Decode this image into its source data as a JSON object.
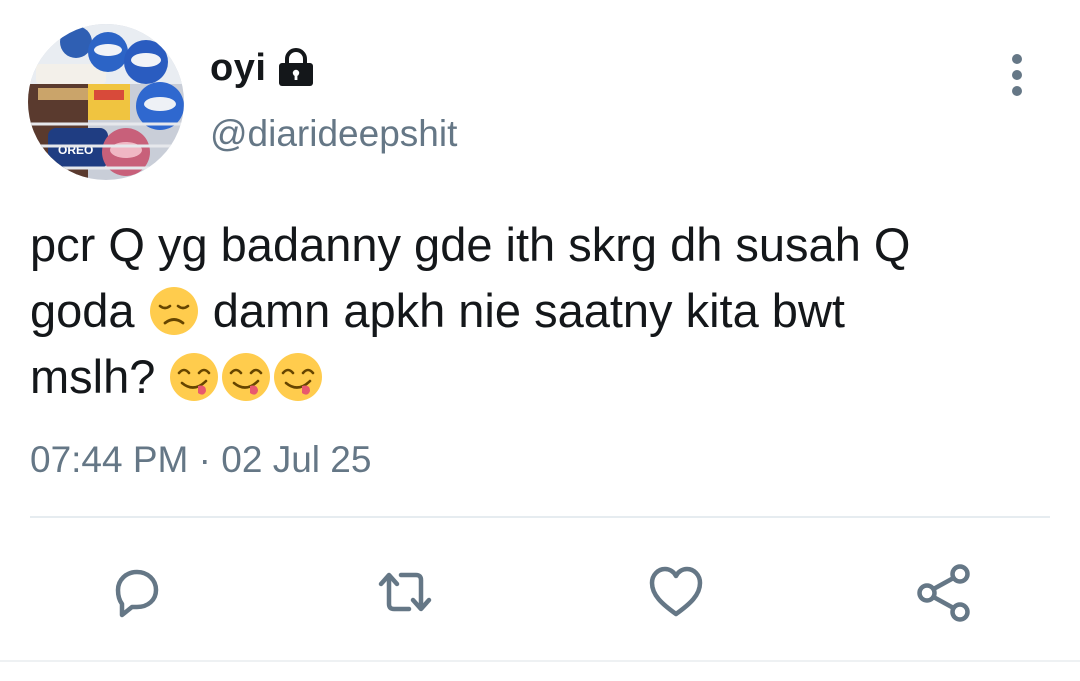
{
  "user": {
    "display_name": "oyi",
    "handle": "@diarideepshit",
    "protected_icon": "lock-icon",
    "avatar_icon": "ice-cream-cups-avatar"
  },
  "tweet": {
    "text_line_1": "pcr Q yg badanny gde ith skrg dh susah Q",
    "text_line_2a": "goda",
    "text_line_2b": "damn apkh nie saatny kita bwt",
    "text_line_3": "mslh?",
    "emojis": [
      "disappointed-face-emoji",
      "savoring-food-face-emoji",
      "savoring-food-face-emoji",
      "savoring-food-face-emoji"
    ],
    "time": "07:44 PM",
    "separator": "·",
    "date": "02 Jul 25"
  },
  "actions": {
    "reply_icon": "reply-icon",
    "retweet_icon": "retweet-icon",
    "like_icon": "heart-icon",
    "share_icon": "share-icon",
    "more_icon": "more-vertical-icon"
  },
  "colors": {
    "text_primary": "#14171a",
    "text_secondary": "#657786",
    "icon_gray": "#657786",
    "divider": "#e6ecf0"
  }
}
